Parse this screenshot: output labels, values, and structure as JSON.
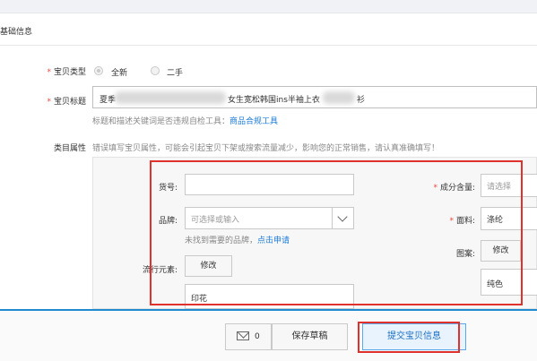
{
  "section": {
    "title": "基础信息"
  },
  "item_type": {
    "label": "宝贝类型",
    "options": [
      "全新",
      "二手"
    ],
    "selected": "全新"
  },
  "item_title": {
    "label": "宝贝标题",
    "value_start": "夏季",
    "value_middle": "女生宽松韩国ins半袖上衣",
    "value_end": "衫"
  },
  "title_hint": {
    "text": "标题和描述关键词是否违规自检工具：",
    "link": "商品合规工具"
  },
  "category": {
    "label": "类目属性",
    "warning": "错误填写宝贝属性，可能会引起宝贝下架或搜索流量减少，影响您的正常销售，请认真准确填写！"
  },
  "attrs": {
    "sku_label": "货号:",
    "sku_value": "",
    "brand_label": "品牌:",
    "brand_placeholder": "可选择或输入",
    "brand_hint": "未找到需要的品牌，",
    "brand_hint_link": "点击申请",
    "style_label": "流行元素:",
    "style_modify": "修改",
    "style_value": "印花",
    "composition_label": "成分含量:",
    "composition_placeholder": "请选择",
    "fabric_label": "面料:",
    "fabric_value": "涤纶",
    "pattern_label": "图案:",
    "pattern_modify": "修改",
    "pattern_value": "纯色"
  },
  "footer": {
    "message_count": "0",
    "save_draft": "保存草稿",
    "submit": "提交宝贝信息"
  },
  "colors": {
    "accent_red": "#e0322c",
    "link_blue": "#1a7bd8",
    "required_star": "#f2453d",
    "submit_border": "#5aa8ea"
  }
}
